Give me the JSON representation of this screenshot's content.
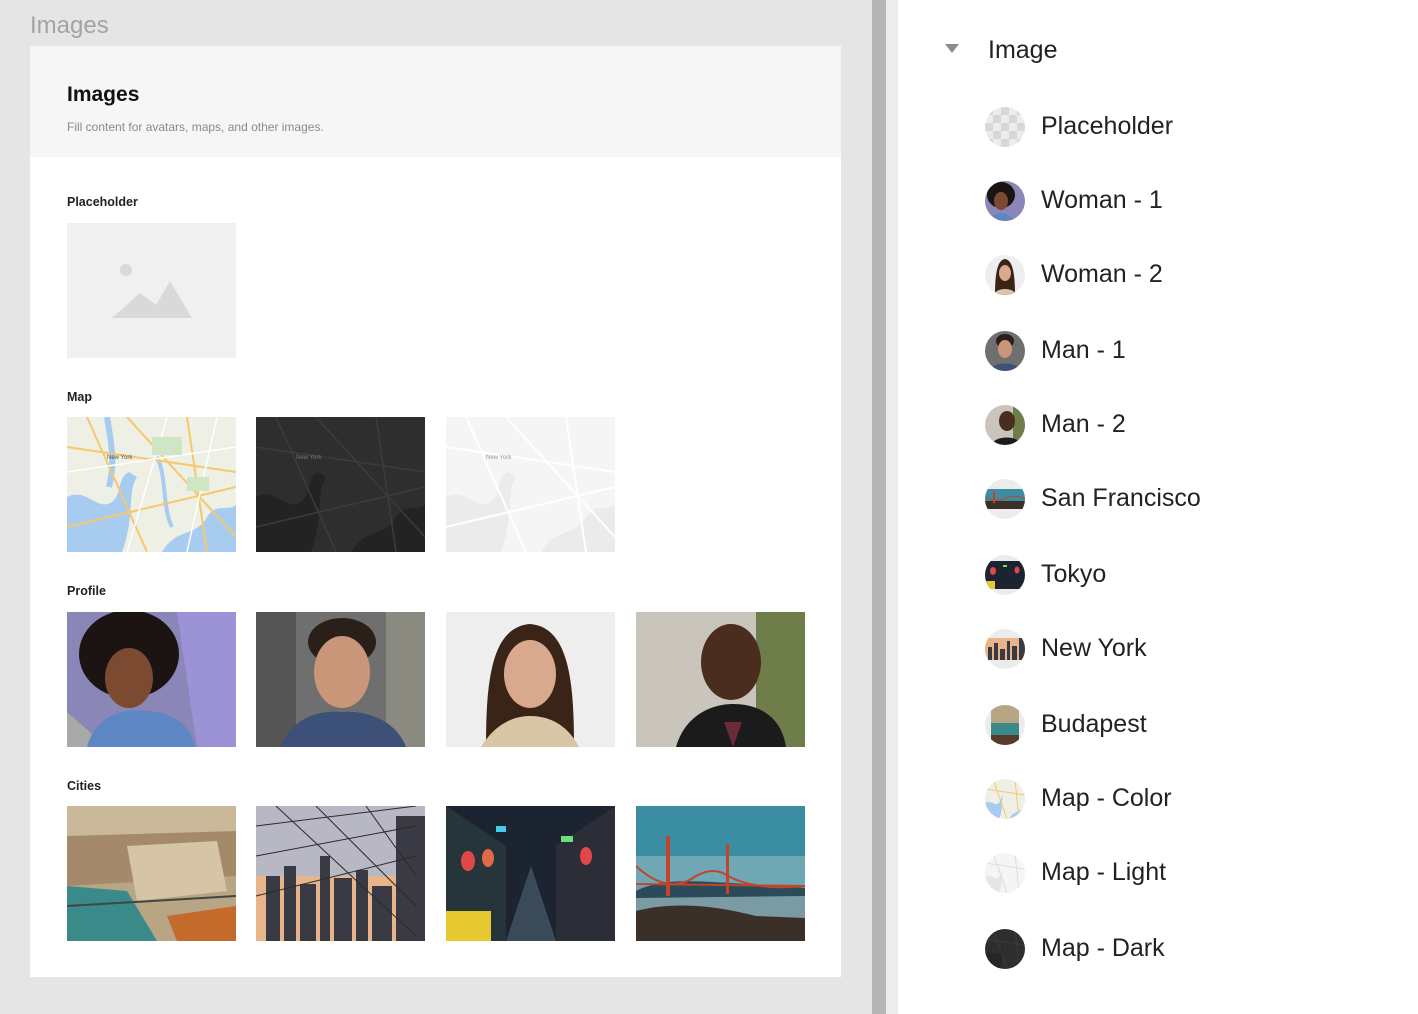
{
  "canvas": {
    "frame_label": "Images",
    "header": {
      "title": "Images",
      "subtitle": "Fill content for avatars, maps, and other images."
    },
    "sections": {
      "placeholder": "Placeholder",
      "map": "Map",
      "profile": "Profile",
      "cities": "Cities"
    },
    "map_labels": {
      "color": "New York",
      "dark": "New York",
      "light": "New York"
    }
  },
  "panel": {
    "group_title": "Image",
    "items": [
      {
        "label": "Placeholder"
      },
      {
        "label": "Woman - 1"
      },
      {
        "label": "Woman - 2"
      },
      {
        "label": "Man - 1"
      },
      {
        "label": "Man - 2"
      },
      {
        "label": "San Francisco"
      },
      {
        "label": "Tokyo"
      },
      {
        "label": "New York"
      },
      {
        "label": "Budapest"
      },
      {
        "label": "Map - Color"
      },
      {
        "label": "Map - Light"
      },
      {
        "label": "Map - Dark"
      }
    ]
  },
  "colors": {
    "canvas_bg": "#e5e5e5",
    "frame_bg": "#ffffff",
    "header_bg": "#f6f6f6",
    "divider": "#b5b5b5",
    "panel_bg": "#ffffff"
  }
}
